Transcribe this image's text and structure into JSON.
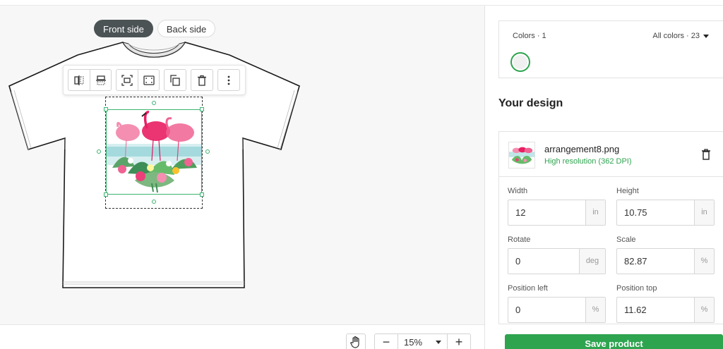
{
  "side_toggle": {
    "front": "Front side",
    "back": "Back side",
    "active": "front"
  },
  "toolbar": {
    "groups": [
      [
        "flip-horizontal-icon",
        "flip-vertical-icon"
      ],
      [
        "center-icon",
        "fit-to-area-icon"
      ],
      [
        "duplicate-icon"
      ],
      [
        "delete-icon"
      ],
      [
        "more-options-icon"
      ]
    ]
  },
  "zoom": {
    "value": "15%",
    "minus": "−",
    "plus": "+"
  },
  "colors": {
    "label": "Colors · 1",
    "all_label": "All colors · 23",
    "selected_swatch": "#f0f0f0",
    "accent": "#2ea44f"
  },
  "design": {
    "heading": "Your design",
    "file_name": "arrangement8.png",
    "resolution": "High resolution (362 DPI)"
  },
  "fields": {
    "width": {
      "label": "Width",
      "value": "12",
      "unit": "in"
    },
    "height": {
      "label": "Height",
      "value": "10.75",
      "unit": "in"
    },
    "rotate": {
      "label": "Rotate",
      "value": "0",
      "unit": "deg"
    },
    "scale": {
      "label": "Scale",
      "value": "82.87",
      "unit": "%"
    },
    "position_left": {
      "label": "Position left",
      "value": "0",
      "unit": "%"
    },
    "position_top": {
      "label": "Position top",
      "value": "11.62",
      "unit": "%"
    }
  },
  "save_button": "Save product"
}
